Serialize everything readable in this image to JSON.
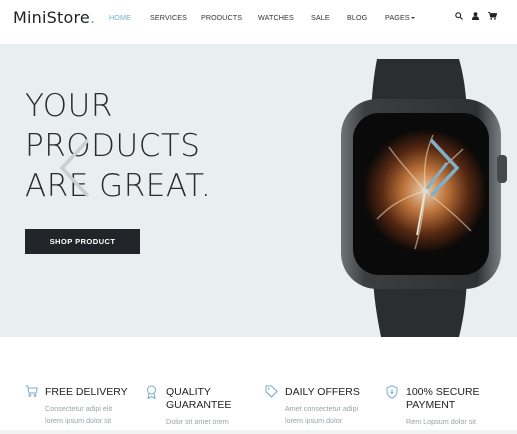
{
  "brand": {
    "name": "MiniStore",
    "dot": ".",
    "accent": "#72aec8"
  },
  "nav": {
    "items": [
      {
        "label": "HOME"
      },
      {
        "label": "SERVICES"
      },
      {
        "label": "PRODUCTS"
      },
      {
        "label": "WATCHES"
      },
      {
        "label": "SALE"
      },
      {
        "label": "BLOG"
      },
      {
        "label": "PAGES"
      }
    ],
    "active": "HOME",
    "icons": [
      "search-icon",
      "user-icon",
      "cart-icon"
    ]
  },
  "hero": {
    "headline": [
      "YOUR",
      "PRODUCTS",
      "ARE GREAT."
    ],
    "button": "SHOP PRODUCT",
    "background": "#e9eef0"
  },
  "features": [
    {
      "icon": "cart-icon",
      "title": [
        "FREE DELIVERY"
      ],
      "desc": [
        "Consectetur adipi elit",
        "lorem ipsum dolor sit"
      ]
    },
    {
      "icon": "award-icon",
      "title": [
        "QUALITY",
        "GUARANTEE"
      ],
      "desc": [
        "Dolor sit amet orem"
      ]
    },
    {
      "icon": "tag-icon",
      "title": [
        "DAILY OFFERS"
      ],
      "desc": [
        "Amet consectetur adipi",
        "lorem ipsum dolor"
      ]
    },
    {
      "icon": "shield-icon",
      "title": [
        "100% SECURE",
        "PAYMENT"
      ],
      "desc": [
        "Rem Lopsum dolor sit"
      ]
    }
  ]
}
